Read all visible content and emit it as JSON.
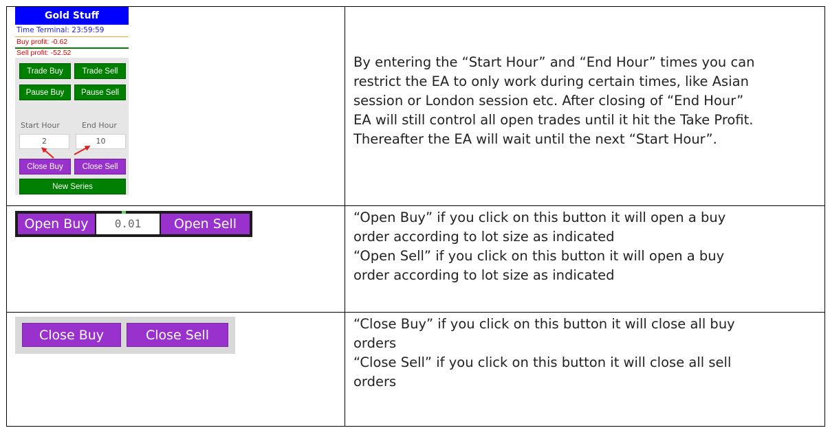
{
  "panel": {
    "title": "Gold Stuff",
    "time_terminal": "Time Terminal: 23:59:59",
    "buy_profit": "Buy profit: -0.62",
    "sell_profit": "Sell profit: -52.52",
    "trade_buy": "Trade Buy",
    "trade_sell": "Trade Sell",
    "pause_buy": "Pause Buy",
    "pause_sell": "Pause Sell",
    "start_hour_label": "Start Hour",
    "end_hour_label": "End Hour",
    "start_hour_value": "2",
    "end_hour_value": "10",
    "close_buy": "Close Buy",
    "close_sell": "Close Sell",
    "new_series": "New Series"
  },
  "open_strip": {
    "open_buy": "Open Buy",
    "lot_size": "0.01",
    "open_sell": "Open Sell"
  },
  "close_strip": {
    "close_buy": "Close Buy",
    "close_sell": "Close Sell"
  },
  "descriptions": {
    "hours": "By entering the “Start Hour” and “End Hour” times you can\nrestrict the EA to only work during certain times, like Asian\nsession or London session etc.  After closing of “End Hour”\nEA will still control all open trades until it hit the Take Profit.\nThereafter the EA will wait until the next “Start Hour”.",
    "open": "“Open Buy” if you click on this button it will open a buy\norder according to lot size as indicated\n“Open Sell” if you click on this button it will open a buy\norder according to lot size as indicated",
    "close": "“Close Buy”  if you click on this button it will close all buy\norders\n“Close Sell”  if you click on this button it will close all sell\norders"
  },
  "colors": {
    "title_blue": "#0000ff",
    "button_green": "#008000",
    "button_purple": "#9932cc",
    "profit_red": "#e00000",
    "arrow_red": "#e02020"
  },
  "icons": {
    "arrows": "red-arrow-icon"
  }
}
